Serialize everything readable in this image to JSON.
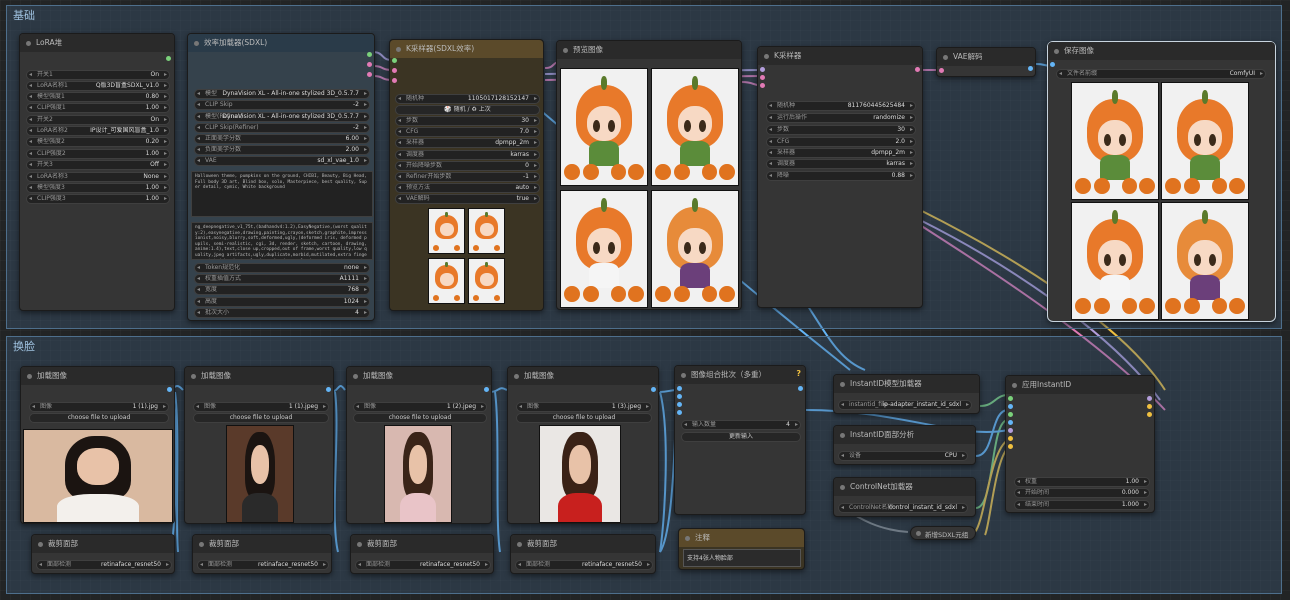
{
  "groups": {
    "basic": "基础",
    "face": "换脸"
  },
  "lora": {
    "title": "LoRA堆",
    "rows": [
      {
        "k": "开关1",
        "v": "On"
      },
      {
        "k": "LoRA名称1",
        "v": "Q版3D盲盒SDXL_v1.0"
      },
      {
        "k": "模型强度1",
        "v": "0.80"
      },
      {
        "k": "CLIP强度1",
        "v": "1.00"
      },
      {
        "k": "开关2",
        "v": "On"
      },
      {
        "k": "LoRA名称2",
        "v": "IP设计_可爱国风盲盒_1.0"
      },
      {
        "k": "模型强度2",
        "v": "0.20"
      },
      {
        "k": "CLIP强度2",
        "v": "1.00"
      },
      {
        "k": "开关3",
        "v": "Off"
      },
      {
        "k": "LoRA名称3",
        "v": "None"
      },
      {
        "k": "模型强度3",
        "v": "1.00"
      },
      {
        "k": "CLIP强度3",
        "v": "1.00"
      }
    ]
  },
  "loader": {
    "title": "效率加载器(SDXL)",
    "rows_top": [
      {
        "k": "模型",
        "v": "DynaVision XL - All-in-one stylized 3D_0.5.7.7"
      },
      {
        "k": "CLIP Skip",
        "v": "-2"
      },
      {
        "k": "模型(Refiner)",
        "v": "DynaVision XL - All-in-one stylized 3D_0.5.7.7"
      },
      {
        "k": "CLIP Skip(Refiner)",
        "v": "-2"
      },
      {
        "k": "正面美学分数",
        "v": "6.00"
      },
      {
        "k": "负面美学分数",
        "v": "2.00"
      },
      {
        "k": "VAE",
        "v": "sd_xl_vae_1.0"
      }
    ],
    "positive": "Halloween theme, pumpkins on the ground, CHIBI, Beauty, Big Head, Full body 3D art, Blind box, solo, Masterpiece, best quality, Super detail, cymic, White background",
    "negative": "ng_deepnegative_v1_75t,(badhandv4:1.2),EasyNegative,(worst quality:2),easynegative,drawing,painting,crayon,sketch,graphite,impressionist,noisy,blurry,soft,deformed,ugly,(deformed iris, deformed pupils, semi-realistic, cgi, 3d, render, sketch, cartoon, drawing, anime:1.4),text,close up,cropped,out of frame,worst quality,low quality,jpeg artifacts,ugly,duplicate,morbid,mutilated,extra fingers,mutated hands,poorly drawn hands,poorly drawn",
    "rows_bottom": [
      {
        "k": "Token规范化",
        "v": "none"
      },
      {
        "k": "权重插值方式",
        "v": "A1111"
      },
      {
        "k": "宽度",
        "v": "768"
      },
      {
        "k": "高度",
        "v": "1024"
      },
      {
        "k": "批次大小",
        "v": "4"
      }
    ]
  },
  "ksampler_sdxl": {
    "title": "K采样器(SDXL效率)",
    "seed_label": "随机种",
    "seed": "1105017128152147",
    "seed_btn": "🎲 随机 / ♻ 上次",
    "rows": [
      {
        "k": "步数",
        "v": "30"
      },
      {
        "k": "CFG",
        "v": "7.0"
      },
      {
        "k": "采样器",
        "v": "dpmpp_2m"
      },
      {
        "k": "调度器",
        "v": "karras"
      },
      {
        "k": "开始降噪步数",
        "v": "0"
      },
      {
        "k": "Refiner开始步数",
        "v": "-1"
      },
      {
        "k": "预览方法",
        "v": "auto"
      },
      {
        "k": "VAE解码",
        "v": "true"
      }
    ]
  },
  "preview": {
    "title": "预览图像"
  },
  "ksampler": {
    "title": "K采样器",
    "rows": [
      {
        "k": "随机种",
        "v": "811760445625484"
      },
      {
        "k": "运行后操作",
        "v": "randomize"
      },
      {
        "k": "步数",
        "v": "30"
      },
      {
        "k": "CFG",
        "v": "2.0"
      },
      {
        "k": "采样器",
        "v": "dpmpp_2m"
      },
      {
        "k": "调度器",
        "v": "karras"
      },
      {
        "k": "降噪",
        "v": "0.88"
      }
    ]
  },
  "vae_decode": {
    "title": "VAE解码"
  },
  "save": {
    "title": "保存图像",
    "prefix_label": "文件名前缀",
    "prefix": "ComfyUI"
  },
  "load_images": [
    {
      "title": "加载图像",
      "image_label": "图像",
      "image": "1 (1).jpg",
      "upload": "choose file to upload"
    },
    {
      "title": "加载图像",
      "image_label": "图像",
      "image": "1 (1).jpeg",
      "upload": "choose file to upload"
    },
    {
      "title": "加载图像",
      "image_label": "图像",
      "image": "1 (2).jpeg",
      "upload": "choose file to upload"
    },
    {
      "title": "加载图像",
      "image_label": "图像",
      "image": "1 (3).jpeg",
      "upload": "choose file to upload"
    }
  ],
  "crop_faces": [
    {
      "title": "裁剪面部",
      "k": "面部检测",
      "v": "retinaface_resnet50"
    },
    {
      "title": "裁剪面部",
      "k": "面部检测",
      "v": "retinaface_resnet50"
    },
    {
      "title": "裁剪面部",
      "k": "面部检测",
      "v": "retinaface_resnet50"
    },
    {
      "title": "裁剪面部",
      "k": "面部检测",
      "v": "retinaface_resnet50"
    }
  ],
  "batch": {
    "title": "图像组合批次（多重）",
    "badge": "?",
    "k": "输入数量",
    "v": "4",
    "btn": "更新输入"
  },
  "note": {
    "title": "注释",
    "text": "支持4张人物脸部"
  },
  "instantid_loader": {
    "title": "InstantID模型加载器",
    "k": "instantid_file",
    "v": "ip-adapter_instant_id_sdxl"
  },
  "face_analysis": {
    "title": "InstantID面部分析",
    "k": "设备",
    "v": "CPU"
  },
  "controlnet": {
    "title": "ControlNet加载器",
    "k": "ControlNet名称",
    "v": "control_instant_id_sdxl"
  },
  "sdxl_meta": {
    "title": "新增SDXL元组"
  },
  "apply": {
    "title": "应用InstantID",
    "rows": [
      {
        "k": "权重",
        "v": "1.00"
      },
      {
        "k": "开始时间",
        "v": "0.000"
      },
      {
        "k": "结束时间",
        "v": "1.000"
      }
    ]
  },
  "colors": {
    "link_blue": "#64b5f6",
    "link_yellow": "#f0c040",
    "link_purple": "#b39ddb",
    "link_pink": "#e27ab5",
    "link_green": "#7bd17b"
  }
}
